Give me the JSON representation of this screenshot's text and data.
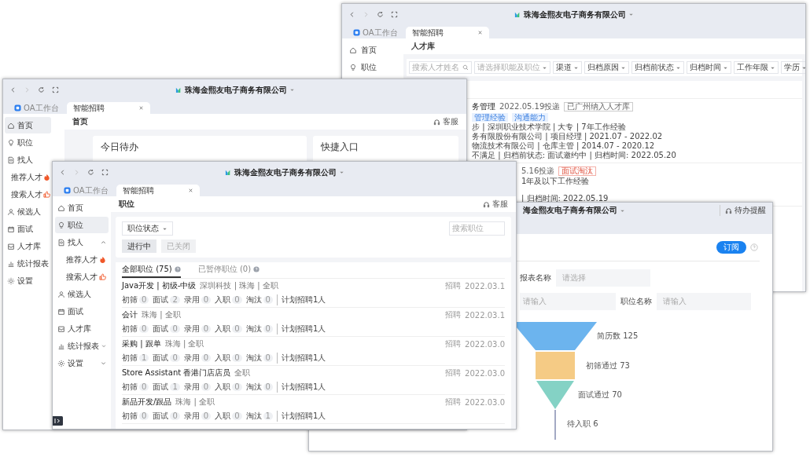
{
  "windows": [
    {
      "kind": "talent",
      "company": "珠海金熙友电子商务有限公司",
      "tabs": [
        {
          "label": "OA工作台",
          "selected": false
        },
        {
          "label": "智能招聘",
          "selected": true
        }
      ],
      "nav": [
        {
          "label": "首页",
          "selected": false
        },
        {
          "label": "职位",
          "selected": false
        }
      ],
      "page_title": "人才库",
      "search": {
        "placeholder": "搜索人才姓名"
      },
      "filters": [
        "请选择职能及职位",
        "渠道",
        "归档原因",
        "归档前状态",
        "归档时间",
        "工作年限",
        "学历"
      ],
      "cards": [
        {
          "title": "务管理",
          "date": "2022.05.19投递",
          "badge": {
            "label": "已广州纳入人才库",
            "kind": "outline"
          },
          "tags": [
            "管理经验",
            "沟通能力"
          ],
          "lines": [
            "步 | 深圳职业技术学院 | 大专 | 7年工作经验",
            "务有限股份有限公司 | 项目经理 | 2021.07 - 2022.02",
            "物流技术有限公司 | 仓库主管 | 2014.07 - 2020.12",
            "不满足 | 归档前状态: 面试邀约中 | 归档时间: 2022.05.20"
          ]
        },
        {
          "date": "5.16投递",
          "badge": {
            "label": "面试淘汰",
            "kind": "danger"
          },
          "lines": [
            "1年及以下工作经验",
            "| 归档时间: 2022.05.19"
          ]
        }
      ]
    },
    {
      "kind": "report",
      "company": "海金熙友电子商务有限公司",
      "notice": "待办提醒",
      "subscribe": "订阅",
      "form": [
        {
          "label": "报表名称",
          "placeholder": "请选择"
        },
        {
          "placeholder": "请输入"
        },
        {
          "label": "职位名称",
          "placeholder": "请输入"
        }
      ],
      "funnel": [
        {
          "label": "简历数 125",
          "color": "#6cb4ee"
        },
        {
          "label": "初筛通过 73",
          "color": "#f5cb85"
        },
        {
          "label": "面试通过 70",
          "color": "#84d2c5"
        },
        {
          "label": "待入职 6",
          "color": "#a3a9c4"
        }
      ]
    },
    {
      "kind": "home",
      "company": "珠海金熙友电子商务有限公司",
      "tabs": [
        {
          "label": "OA工作台",
          "selected": false
        },
        {
          "label": "智能招聘",
          "selected": true
        }
      ],
      "nav": [
        {
          "label": "首页",
          "selected": true
        },
        {
          "label": "职位",
          "selected": false
        },
        {
          "label": "找人",
          "selected": false,
          "children": [
            {
              "label": "推荐人才",
              "selected": false
            },
            {
              "label": "搜索人才",
              "selected": false
            }
          ]
        },
        {
          "label": "候选人",
          "selected": false
        },
        {
          "label": "面试",
          "selected": false
        },
        {
          "label": "人才库",
          "selected": false
        },
        {
          "label": "统计报表",
          "selected": false
        },
        {
          "label": "设置",
          "selected": false
        }
      ],
      "page_title": "首页",
      "service": "客服",
      "cards": [
        "今日待办",
        "快捷入口"
      ]
    },
    {
      "kind": "jobs",
      "company": "珠海金熙友电子商务有限公司",
      "tabs": [
        {
          "label": "OA工作台",
          "selected": false
        },
        {
          "label": "智能招聘",
          "selected": true
        }
      ],
      "nav": [
        {
          "label": "首页",
          "selected": false
        },
        {
          "label": "职位",
          "selected": true
        },
        {
          "label": "找人",
          "selected": false,
          "expanded": true,
          "children": [
            {
              "label": "推荐人才",
              "selected": false
            },
            {
              "label": "搜索人才",
              "selected": false
            }
          ]
        },
        {
          "label": "候选人",
          "selected": false
        },
        {
          "label": "面试",
          "selected": false
        },
        {
          "label": "人才库",
          "selected": false
        },
        {
          "label": "统计报表",
          "selected": false,
          "expanded": false
        },
        {
          "label": "设置",
          "selected": false,
          "expanded": false
        }
      ],
      "page_title": "职位",
      "service": "客服",
      "status_filter": "职位状态",
      "status_buttons": [
        {
          "label": "进行中",
          "selected": true
        },
        {
          "label": "已关闭",
          "selected": false
        }
      ],
      "search": {
        "placeholder": "搜索职位"
      },
      "list_tabs": [
        {
          "label": "全部职位 (75)",
          "selected": true
        },
        {
          "label": "已暂停职位 (0)",
          "selected": false
        }
      ],
      "jobs": [
        {
          "title": "Java开发 | 初级-中级",
          "meta": "深圳科技 | 珠海 | 全职",
          "status": "招聘",
          "date": "2022.03.1",
          "stats": [
            {
              "label": "初筛",
              "count": "0"
            },
            {
              "label": "面试",
              "count": "2"
            },
            {
              "label": "录用",
              "count": "0"
            },
            {
              "label": "入职",
              "count": "0"
            },
            {
              "label": "淘汰",
              "count": "0"
            }
          ],
          "plan": "计划招聘1人"
        },
        {
          "title": "会计",
          "meta": "珠海 | 全职",
          "status": "招聘",
          "date": "2022.03.1",
          "stats": [
            {
              "label": "初筛",
              "count": "0"
            },
            {
              "label": "面试",
              "count": "0"
            },
            {
              "label": "录用",
              "count": "0"
            },
            {
              "label": "入职",
              "count": "0"
            },
            {
              "label": "淘汰",
              "count": "0"
            }
          ],
          "plan": "计划招聘1人"
        },
        {
          "title": "采购 | 跟单",
          "meta": "珠海 | 全职",
          "status": "招聘",
          "date": "2022.03.0",
          "stats": [
            {
              "label": "初筛",
              "count": "1"
            },
            {
              "label": "面试",
              "count": "0"
            },
            {
              "label": "录用",
              "count": "0"
            },
            {
              "label": "入职",
              "count": "0"
            },
            {
              "label": "淘汰",
              "count": "0"
            }
          ],
          "plan": "计划招聘1人"
        },
        {
          "title": "Store Assistant 香港门店店员",
          "meta": "全职",
          "status": "招聘",
          "date": "2022.03.0",
          "stats": [
            {
              "label": "初筛",
              "count": "0"
            },
            {
              "label": "面试",
              "count": "1"
            },
            {
              "label": "录用",
              "count": "0"
            },
            {
              "label": "入职",
              "count": "0"
            },
            {
              "label": "淘汰",
              "count": "0"
            }
          ],
          "plan": "计划招聘1人"
        },
        {
          "title": "新品开发/跟品",
          "meta": "珠海 | 全职",
          "status": "招聘",
          "date": "2022.03.0",
          "stats": [
            {
              "label": "初筛",
              "count": "0"
            },
            {
              "label": "面试",
              "count": "0"
            },
            {
              "label": "录用",
              "count": "0"
            },
            {
              "label": "入职",
              "count": "0"
            },
            {
              "label": "淘汰",
              "count": "1"
            }
          ],
          "plan": "计划招聘1人"
        }
      ]
    }
  ]
}
